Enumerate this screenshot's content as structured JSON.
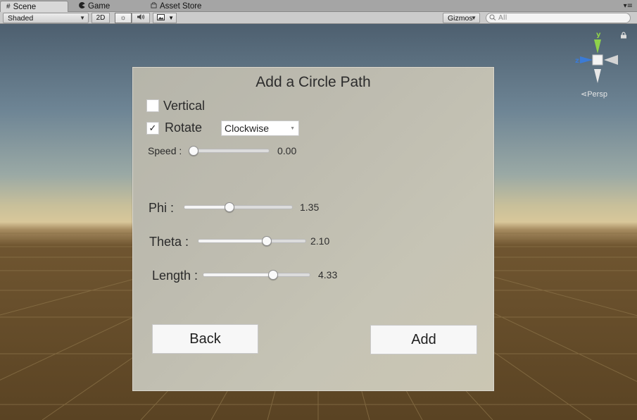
{
  "tabs": [
    {
      "label": "Scene",
      "icon": "grid-icon",
      "active": true
    },
    {
      "label": "Game",
      "icon": "pacman-icon",
      "active": false
    },
    {
      "label": "Asset Store",
      "icon": "shopping-bag-icon",
      "active": false
    }
  ],
  "toolbar": {
    "draw_mode": "Shaded",
    "mode_2d": "2D",
    "gizmos": "Gizmos",
    "search_placeholder": "All"
  },
  "gizmo": {
    "y_label": "y",
    "z_label": "z",
    "projection": "Persp",
    "colors": {
      "y": "#8fd24a",
      "z": "#3b7bd6",
      "neutral": "#e8e8e8"
    }
  },
  "panel": {
    "title": "Add a Circle Path",
    "vertical": {
      "label": "Vertical",
      "checked": false
    },
    "rotate": {
      "label": "Rotate",
      "checked": true,
      "check_mark": "✓"
    },
    "direction": {
      "selected": "Clockwise"
    },
    "speed": {
      "label": "Speed :",
      "value_text": "0.00",
      "fraction": 0.0
    },
    "phi": {
      "label": "Phi :",
      "value_text": "1.35",
      "fraction": 0.41
    },
    "theta": {
      "label": "Theta :",
      "value_text": "2.10",
      "fraction": 0.65
    },
    "length": {
      "label": "Length :",
      "value_text": "4.33",
      "fraction": 0.67
    },
    "back_label": "Back",
    "add_label": "Add"
  }
}
